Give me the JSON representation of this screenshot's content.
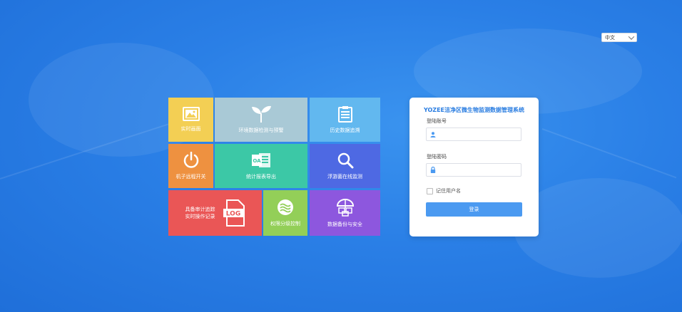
{
  "language": {
    "selected": "中文"
  },
  "tiles": [
    {
      "label": "实时画面",
      "icon": "picture-icon"
    },
    {
      "label": "环境数据检测与预警",
      "icon": "sprout-icon"
    },
    {
      "label": "历史数据追溯",
      "icon": "clipboard-icon"
    },
    {
      "label": "机子远程开关",
      "icon": "power-icon"
    },
    {
      "label": "统计报表导出",
      "icon": "office-oa-icon"
    },
    {
      "label": "浮游菌在线监测",
      "icon": "magnifier-icon"
    },
    {
      "line1": "具备审计追踪",
      "line2": "实时操作记录",
      "icon": "log-icon"
    },
    {
      "label": "权限分级控制",
      "icon": "wave-circle-icon"
    },
    {
      "label": "数据备份与安全",
      "icon": "umbrella-boxes-icon"
    }
  ],
  "login": {
    "title": "YOZEE洁净区微生物监测数据管理系统",
    "account_label": "登陆账号",
    "account_value": "",
    "password_label": "登陆密码",
    "password_value": "",
    "remember_label": "记住用户名",
    "remember_checked": false,
    "submit_label": "登录"
  },
  "colors": {
    "accent": "#4b9af1",
    "title": "#2a7de1",
    "tile_yellow": "#f3cf54",
    "tile_grayblue": "#a9c9d6",
    "tile_lightblue": "#62b8ef",
    "tile_orange": "#ee9140",
    "tile_teal": "#3cc8a6",
    "tile_indigo": "#4e69e3",
    "tile_red": "#ea5656",
    "tile_green": "#93cf58",
    "tile_purple": "#8d57de"
  }
}
